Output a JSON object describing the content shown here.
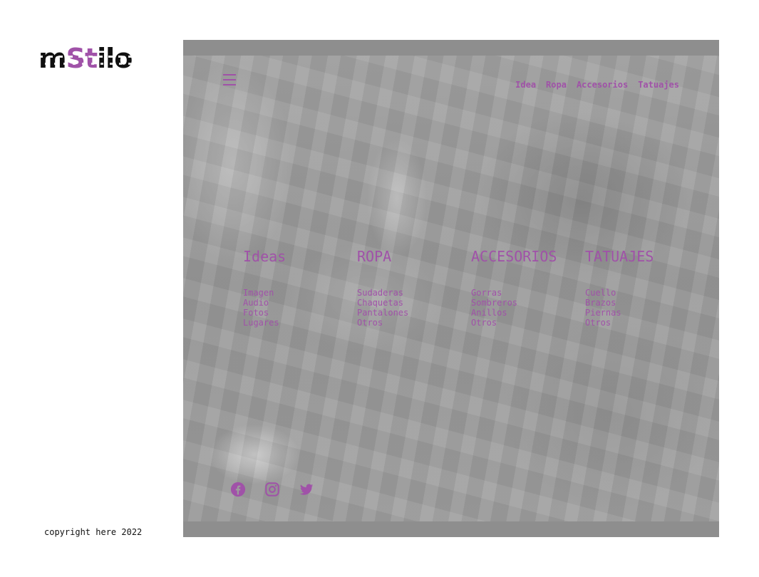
{
  "brand": {
    "logo_text": "mStilo",
    "logo_dark_1": "m",
    "logo_accent": "St",
    "logo_dark_2": "ilo"
  },
  "header": {
    "menu_icon": "hamburger-icon",
    "nav": [
      {
        "label": "Idea"
      },
      {
        "label": "Ropa"
      },
      {
        "label": "Accesorios"
      },
      {
        "label": "Tatuajes"
      }
    ]
  },
  "categories": [
    {
      "title": "Ideas",
      "items": [
        "Imagen",
        "Audio",
        "Fotos",
        "Lugares"
      ]
    },
    {
      "title": "ROPA",
      "items": [
        "Sudaderas",
        "Chaquetas",
        "Pantalones",
        "Otros"
      ]
    },
    {
      "title": "ACCESORIOS",
      "items": [
        "Gorras",
        "Sombreros",
        "Anillos",
        "Otros"
      ]
    },
    {
      "title": "TATUAJES",
      "items": [
        "Cuello",
        "Brazos",
        "Piernas",
        "Otros"
      ]
    }
  ],
  "social": [
    {
      "icon": "facebook-icon"
    },
    {
      "icon": "instagram-icon"
    },
    {
      "icon": "twitter-icon"
    }
  ],
  "footer": {
    "copyright": "copyright here 2022"
  },
  "colors": {
    "accent": "#a052a8",
    "frame": "#8e8e8e",
    "text_dark": "#111111"
  }
}
